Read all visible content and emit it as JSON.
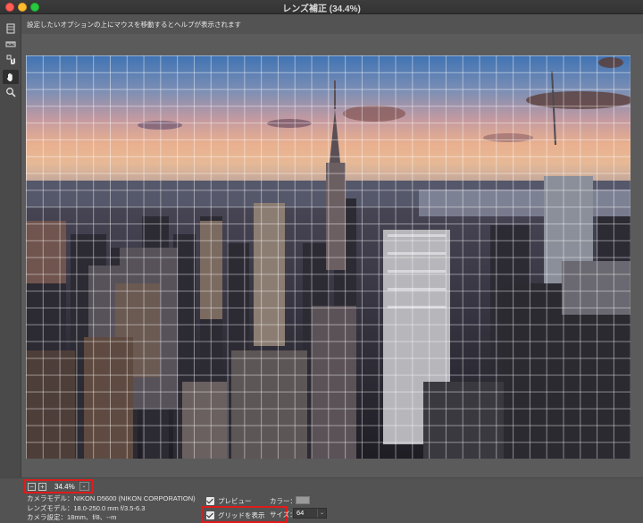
{
  "window": {
    "title": "レンズ補正 (34.4%)"
  },
  "hint": {
    "text": "設定したいオプションの上にマウスを移動するとヘルプが表示されます"
  },
  "tools": [
    {
      "icon": "remove-distortion-icon"
    },
    {
      "icon": "straighten-icon"
    },
    {
      "icon": "move-grid-icon"
    },
    {
      "icon": "hand-icon",
      "active": true
    },
    {
      "icon": "zoom-icon"
    }
  ],
  "zoom": {
    "minus": "−",
    "plus": "+",
    "value": "34.4%",
    "dropdown": "⌄"
  },
  "camera_info": {
    "line1": "カメラモデル：NIKON D5600 (NIKON CORPORATION)",
    "line2": "レンズモデル：18.0-250.0 mm f/3.5-6.3",
    "line3": "カメラ設定：18mm、f/8、--m"
  },
  "options": {
    "preview_label": "プレビュー",
    "show_grid_label": "グリッドを表示",
    "color_label": "カラー：",
    "size_label": "サイズ：",
    "size_value": "64",
    "grid_color": "#9a9a9a"
  },
  "colors": {
    "highlight": "#e01b1b",
    "panel": "#535353"
  }
}
